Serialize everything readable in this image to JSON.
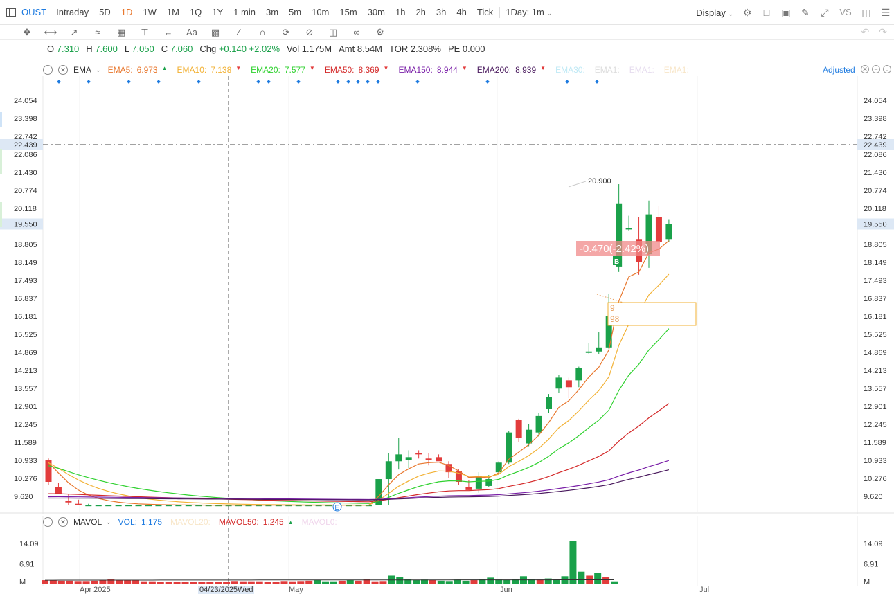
{
  "topbar": {
    "symbol": "OUST",
    "timeframes": [
      "Intraday",
      "5D",
      "1D",
      "1W",
      "1M",
      "1Q",
      "1Y",
      "1 min",
      "3m",
      "5m",
      "10m",
      "15m",
      "30m",
      "1h",
      "2h",
      "3h",
      "4h",
      "Tick"
    ],
    "active_timeframe": "1D",
    "period_select": "1Day: 1m",
    "display_label": "Display",
    "vs_label": "VS"
  },
  "ohlc": {
    "open_label": "O",
    "open": "7.310",
    "high_label": "H",
    "high": "7.600",
    "low_label": "L",
    "low": "7.050",
    "close_label": "C",
    "close": "7.060",
    "chg_label": "Chg",
    "chg": "+0.140",
    "chg_pct": "+2.02%",
    "vol_label": "Vol",
    "vol": "1.175M",
    "amt_label": "Amt",
    "amt": "8.54M",
    "tor_label": "TOR",
    "tor": "2.308%",
    "pe_label": "PE",
    "pe": "0.000"
  },
  "ema_legend": {
    "name": "EMA",
    "items": [
      {
        "label": "EMA5:",
        "value": "6.973",
        "dir": "up",
        "color": "#e8762c"
      },
      {
        "label": "EMA10:",
        "value": "7.138",
        "dir": "down",
        "color": "#f2b134"
      },
      {
        "label": "EMA20:",
        "value": "7.577",
        "dir": "down",
        "color": "#2fd12f"
      },
      {
        "label": "EMA50:",
        "value": "8.369",
        "dir": "down",
        "color": "#d42a2a"
      },
      {
        "label": "EMA150:",
        "value": "8.944",
        "dir": "down",
        "color": "#7a1fa8"
      },
      {
        "label": "EMA200:",
        "value": "8.939",
        "dir": "down",
        "color": "#4a1a5e"
      },
      {
        "label": "EMA30:",
        "value": "",
        "dir": "",
        "color": "#bfe9f5"
      },
      {
        "label": "EMA1:",
        "value": "",
        "dir": "",
        "color": "#ddd"
      },
      {
        "label": "EMA1:",
        "value": "",
        "dir": "",
        "color": "#e6dcef"
      },
      {
        "label": "EMA1:",
        "value": "",
        "dir": "",
        "color": "#f8e6c8"
      }
    ],
    "adjusted_label": "Adjusted"
  },
  "price_axis": {
    "ticks": [
      "24.054",
      "23.398",
      "22.742",
      "22.086",
      "21.430",
      "20.774",
      "20.118",
      "18.805",
      "18.149",
      "17.493",
      "16.837",
      "16.181",
      "15.525",
      "14.869",
      "14.213",
      "13.557",
      "12.901",
      "12.245",
      "11.589",
      "10.933",
      "10.276",
      "9.620"
    ],
    "crosshair_price": "22.439",
    "last_price": "19.550"
  },
  "annotations": {
    "high_label": "20.900",
    "change_badge": "-0.470(-2.42%)",
    "buy_marker": "B",
    "earnings_marker": "E",
    "box_lines": [
      "9",
      "98"
    ]
  },
  "volume_legend": {
    "name": "MAVOL",
    "vol_label": "VOL:",
    "vol_value": "1.175",
    "mavol20_label": "MAVOL20:",
    "mavol50_label": "MAVOL50:",
    "mavol50_value": "1.245",
    "mavol0_label": "MAVOL0:"
  },
  "volume_axis": {
    "ticks": [
      "14.09",
      "6.91",
      "M"
    ]
  },
  "date_axis": {
    "labels": [
      "Apr 2025",
      "May",
      "Jun",
      "Jul"
    ],
    "cursor_date": "04/23/2025Wed"
  },
  "colors": {
    "up": "#1aa14a",
    "down": "#e23c3c",
    "accent": "#1e7be0",
    "active_tf": "#e8762c"
  },
  "chart_data": {
    "type": "candlestick",
    "ylim": [
      9.3,
      24.4
    ],
    "candles": [
      {
        "o": 10.95,
        "h": 11.0,
        "l": 10.05,
        "c": 10.15
      },
      {
        "o": 9.95,
        "h": 10.1,
        "l": 9.7,
        "c": 9.72
      },
      {
        "o": 9.45,
        "h": 9.7,
        "l": 9.3,
        "c": 9.4
      },
      {
        "o": 9.35,
        "h": 9.5,
        "l": 9.3,
        "c": 9.32
      },
      {
        "o": 9.3,
        "h": 9.35,
        "l": 9.3,
        "c": 9.3
      },
      {
        "o": 9.3,
        "h": 9.3,
        "l": 9.3,
        "c": 9.3
      },
      {
        "o": 9.3,
        "h": 9.3,
        "l": 9.3,
        "c": 9.3
      },
      {
        "o": 9.3,
        "h": 9.3,
        "l": 9.3,
        "c": 9.3
      },
      {
        "o": 9.3,
        "h": 9.3,
        "l": 9.3,
        "c": 9.3
      },
      {
        "o": 9.3,
        "h": 9.3,
        "l": 9.3,
        "c": 9.3
      },
      {
        "o": 9.3,
        "h": 9.3,
        "l": 9.3,
        "c": 9.3
      },
      {
        "o": 9.3,
        "h": 9.3,
        "l": 9.3,
        "c": 9.3
      },
      {
        "o": 9.3,
        "h": 9.3,
        "l": 9.3,
        "c": 9.3
      },
      {
        "o": 9.3,
        "h": 9.3,
        "l": 9.3,
        "c": 9.3
      },
      {
        "o": 9.3,
        "h": 9.3,
        "l": 9.3,
        "c": 9.3
      },
      {
        "o": 9.3,
        "h": 9.3,
        "l": 9.3,
        "c": 9.3
      },
      {
        "o": 9.3,
        "h": 9.3,
        "l": 9.3,
        "c": 9.3
      },
      {
        "o": 9.3,
        "h": 9.3,
        "l": 9.3,
        "c": 9.3
      },
      {
        "o": 9.3,
        "h": 9.3,
        "l": 9.3,
        "c": 9.3
      },
      {
        "o": 9.3,
        "h": 9.3,
        "l": 9.3,
        "c": 9.3
      },
      {
        "o": 9.3,
        "h": 9.3,
        "l": 9.3,
        "c": 9.3
      },
      {
        "o": 9.3,
        "h": 9.3,
        "l": 9.3,
        "c": 9.3
      },
      {
        "o": 9.3,
        "h": 9.3,
        "l": 9.3,
        "c": 9.3
      },
      {
        "o": 9.3,
        "h": 9.3,
        "l": 9.3,
        "c": 9.3
      },
      {
        "o": 9.3,
        "h": 9.3,
        "l": 9.3,
        "c": 9.3
      },
      {
        "o": 9.3,
        "h": 9.3,
        "l": 9.3,
        "c": 9.3
      },
      {
        "o": 9.3,
        "h": 9.3,
        "l": 9.3,
        "c": 9.3
      },
      {
        "o": 9.3,
        "h": 9.3,
        "l": 9.3,
        "c": 9.3
      },
      {
        "o": 9.3,
        "h": 9.3,
        "l": 9.3,
        "c": 9.3
      },
      {
        "o": 9.3,
        "h": 9.3,
        "l": 9.3,
        "c": 9.3
      },
      {
        "o": 9.3,
        "h": 9.3,
        "l": 9.3,
        "c": 9.3
      },
      {
        "o": 9.3,
        "h": 9.3,
        "l": 9.3,
        "c": 9.3
      },
      {
        "o": 9.3,
        "h": 9.3,
        "l": 9.3,
        "c": 9.3
      },
      {
        "o": 9.3,
        "h": 9.65,
        "l": 9.3,
        "c": 10.25
      },
      {
        "o": 10.25,
        "h": 11.2,
        "l": 9.3,
        "c": 10.9
      },
      {
        "o": 10.9,
        "h": 11.75,
        "l": 10.6,
        "c": 11.15
      },
      {
        "o": 10.95,
        "h": 11.3,
        "l": 10.65,
        "c": 11.05
      },
      {
        "o": 11.2,
        "h": 11.3,
        "l": 11.0,
        "c": 11.15
      },
      {
        "o": 11.0,
        "h": 11.2,
        "l": 10.75,
        "c": 10.95
      },
      {
        "o": 11.05,
        "h": 11.15,
        "l": 10.95,
        "c": 10.9
      },
      {
        "o": 10.8,
        "h": 10.9,
        "l": 10.3,
        "c": 10.5
      },
      {
        "o": 10.55,
        "h": 10.6,
        "l": 10.05,
        "c": 10.15
      },
      {
        "o": 9.95,
        "h": 10.2,
        "l": 9.85,
        "c": 9.85
      },
      {
        "o": 9.9,
        "h": 10.5,
        "l": 9.75,
        "c": 10.35
      },
      {
        "o": 10.0,
        "h": 10.4,
        "l": 9.95,
        "c": 10.25
      },
      {
        "o": 10.5,
        "h": 10.9,
        "l": 10.4,
        "c": 10.85
      },
      {
        "o": 10.85,
        "h": 12.0,
        "l": 10.8,
        "c": 11.95
      },
      {
        "o": 12.4,
        "h": 12.45,
        "l": 11.6,
        "c": 11.75
      },
      {
        "o": 11.55,
        "h": 12.25,
        "l": 11.45,
        "c": 12.05
      },
      {
        "o": 11.95,
        "h": 12.65,
        "l": 11.8,
        "c": 12.55
      },
      {
        "o": 12.8,
        "h": 13.35,
        "l": 12.65,
        "c": 13.25
      },
      {
        "o": 13.55,
        "h": 14.05,
        "l": 13.4,
        "c": 13.95
      },
      {
        "o": 13.85,
        "h": 13.95,
        "l": 13.2,
        "c": 13.6
      },
      {
        "o": 13.85,
        "h": 14.35,
        "l": 13.6,
        "c": 14.3
      },
      {
        "o": 14.85,
        "h": 15.2,
        "l": 14.8,
        "c": 14.9
      },
      {
        "o": 14.9,
        "h": 15.6,
        "l": 14.8,
        "c": 15.05
      },
      {
        "o": 15.05,
        "h": 17.0,
        "l": 15.0,
        "c": 16.2
      },
      {
        "o": 18.0,
        "h": 21.0,
        "l": 17.8,
        "c": 20.3
      },
      {
        "o": 19.35,
        "h": 19.85,
        "l": 19.3,
        "c": 19.4
      },
      {
        "o": 19.0,
        "h": 19.8,
        "l": 17.7,
        "c": 18.15
      },
      {
        "o": 18.45,
        "h": 20.4,
        "l": 17.95,
        "c": 19.9
      },
      {
        "o": 19.8,
        "h": 20.2,
        "l": 18.7,
        "c": 18.9
      },
      {
        "o": 19.0,
        "h": 19.7,
        "l": 18.9,
        "c": 19.55
      }
    ],
    "volumes": [
      1.2,
      1.1,
      1.0,
      1.0,
      0.9,
      0.9,
      1.0,
      1.1,
      1.5,
      1.2,
      1.3,
      1.1,
      0.8,
      0.8,
      0.7,
      0.6,
      0.6,
      0.7,
      0.6,
      0.6,
      0.5,
      0.6,
      0.7,
      0.9,
      0.8,
      0.8,
      0.8,
      0.7,
      0.7,
      0.9,
      0.8,
      0.9,
      1.0,
      1.2,
      0.8,
      0.8,
      1.0,
      1.2,
      1.0,
      1.6,
      0.8,
      0.9,
      2.8,
      2.2,
      1.5,
      1.2,
      1.4,
      1.3,
      1.0,
      0.9,
      1.4,
      1.0,
      1.2,
      1.6,
      2.1,
      1.4,
      1.3,
      1.7,
      2.6,
      1.7,
      1.4,
      1.8,
      1.7,
      2.6,
      14.9,
      4.2,
      2.8,
      3.8,
      2.2,
      0.8
    ],
    "volume_up": [
      0,
      0,
      0,
      0,
      0,
      0,
      0,
      0,
      0,
      0,
      0,
      0,
      0,
      0,
      0,
      0,
      0,
      0,
      0,
      0,
      0,
      0,
      0,
      0,
      0,
      0,
      0,
      0,
      0,
      0,
      0,
      0,
      0,
      1,
      1,
      1,
      0,
      1,
      0,
      0,
      0,
      0,
      1,
      1,
      1,
      1,
      1,
      0,
      1,
      1,
      1,
      1,
      0,
      1,
      1,
      1,
      1,
      1,
      1,
      1,
      0,
      1,
      1,
      1,
      1,
      1,
      0,
      1,
      0,
      1
    ]
  }
}
